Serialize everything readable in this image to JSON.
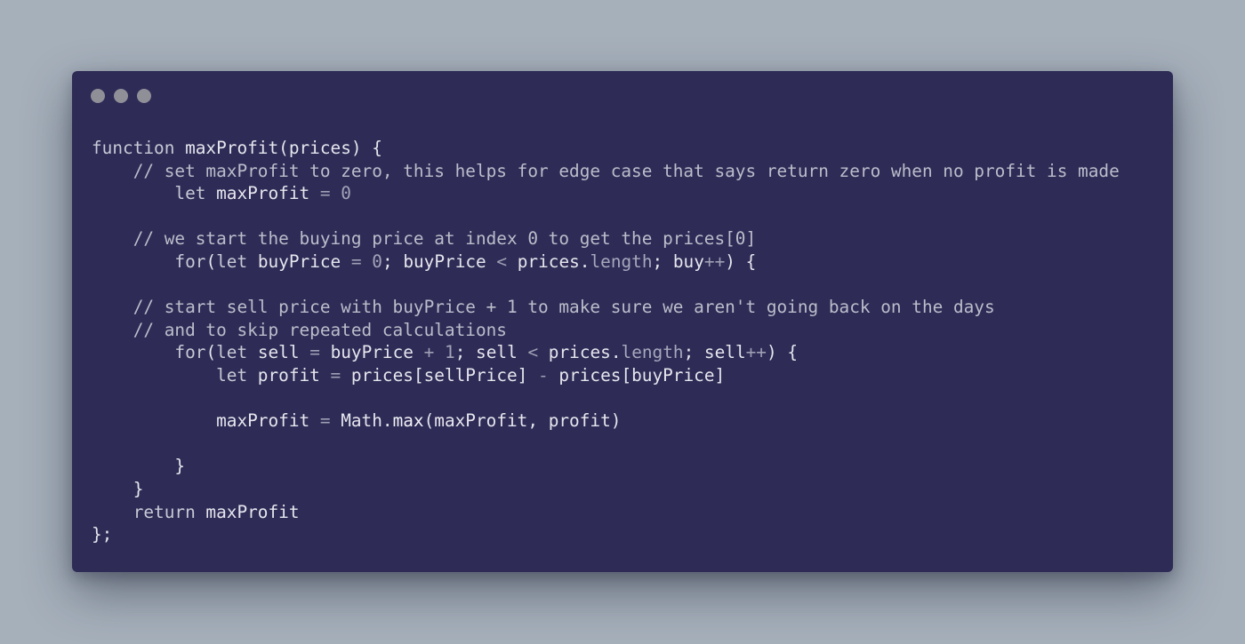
{
  "window": {
    "buttons": [
      "close",
      "minimize",
      "maximize"
    ],
    "colors": {
      "background": "#2e2b56",
      "page": "#a6b0bb",
      "dot": "#8f8f98"
    }
  },
  "code": {
    "line1": {
      "kw": "function",
      "rest": " maxProfit(prices) {"
    },
    "line2": {
      "indent": "    ",
      "comment": "// set maxProfit to zero, this helps for edge case that says return zero when no profit is made"
    },
    "line3": {
      "indent": "        ",
      "kw": "let",
      "rest": " maxProfit ",
      "op": "=",
      "num": " 0"
    },
    "line4": {},
    "line5": {
      "indent": "    ",
      "comment": "// we start the buying price at index 0 to get the prices[0]"
    },
    "line6": {
      "indent": "        ",
      "kw1": "for",
      "p1": "(",
      "kw2": "let",
      "p2": " buyPrice ",
      "op1": "=",
      "p3": " ",
      "num1": "0",
      "p4": "; buyPrice ",
      "op2": "<",
      "p5": " prices.",
      "prop": "length",
      "p6": "; buy",
      "op3": "++",
      "p7": ") {"
    },
    "line7": {},
    "line8": {
      "indent": "    ",
      "comment": "// start sell price with buyPrice + 1 to make sure we aren't going back on the days"
    },
    "line9": {
      "indent": "    ",
      "comment": "// and to skip repeated calculations"
    },
    "line10": {
      "indent": "        ",
      "kw1": "for",
      "p1": "(",
      "kw2": "let",
      "p2": " sell ",
      "op1": "=",
      "p3": " buyPrice ",
      "op2": "+",
      "p4": " ",
      "num1": "1",
      "p5": "; sell ",
      "op3": "<",
      "p6": " prices.",
      "prop": "length",
      "p7": "; sell",
      "op4": "++",
      "p8": ") {"
    },
    "line11": {
      "indent": "            ",
      "kw": "let",
      "p1": " profit ",
      "op1": "=",
      "p2": " prices[sellPrice] ",
      "op2": "-",
      "p3": " prices[buyPrice]"
    },
    "line12": {},
    "line13": {
      "indent": "            ",
      "p1": "maxProfit ",
      "op1": "=",
      "p2": " Math.",
      "fn": "max",
      "p3": "(maxProfit, profit)"
    },
    "line14": {},
    "line15": {
      "indent": "        ",
      "text": "}"
    },
    "line16": {
      "indent": "    ",
      "text": "}"
    },
    "line17": {
      "indent": "    ",
      "kw": "return",
      "rest": " maxProfit"
    },
    "line18": {
      "text": "};"
    }
  }
}
